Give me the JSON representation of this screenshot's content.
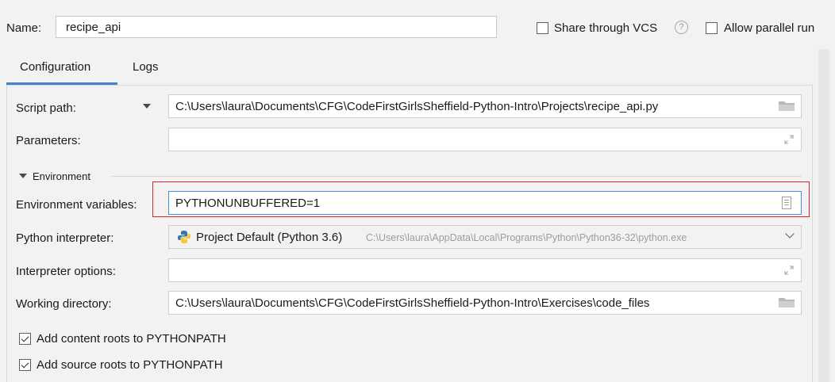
{
  "header": {
    "name_label": "Name:",
    "name_value": "recipe_api",
    "share_vcs_label": "Share through VCS",
    "share_vcs_checked": false,
    "help_glyph": "?",
    "allow_parallel_label": "Allow parallel run",
    "allow_parallel_checked": false
  },
  "tabs": [
    {
      "label": "Configuration",
      "active": true
    },
    {
      "label": "Logs",
      "active": false
    }
  ],
  "form": {
    "script_path": {
      "label": "Script path:",
      "value": "C:\\Users\\laura\\Documents\\CFG\\CodeFirstGirlsSheffield-Python-Intro\\Projects\\recipe_api.py"
    },
    "parameters": {
      "label": "Parameters:",
      "value": ""
    },
    "environment_section": {
      "title": "Environment",
      "expanded": true
    },
    "environment_variables": {
      "label": "Environment variables:",
      "value": "PYTHONUNBUFFERED=1"
    },
    "python_interpreter": {
      "label": "Python interpreter:",
      "value": "Project Default (Python 3.6)",
      "path": "C:\\Users\\laura\\AppData\\Local\\Programs\\Python\\Python36-32\\python.exe"
    },
    "interpreter_options": {
      "label": "Interpreter options:",
      "value": ""
    },
    "working_directory": {
      "label": "Working directory:",
      "value": "C:\\Users\\laura\\Documents\\CFG\\CodeFirstGirlsSheffield-Python-Intro\\Exercises\\code_files"
    },
    "add_content_roots": {
      "label": "Add content roots to PYTHONPATH",
      "checked": true
    },
    "add_source_roots": {
      "label": "Add source roots to PYTHONPATH",
      "checked": true
    }
  },
  "icons": {
    "folder": "folder-icon",
    "expand": "expand-icon",
    "env_editor": "document-icon",
    "python": "python-icon"
  },
  "colors": {
    "accent": "#4083c9",
    "highlight": "#d9252b",
    "background": "#f2f2f2"
  }
}
